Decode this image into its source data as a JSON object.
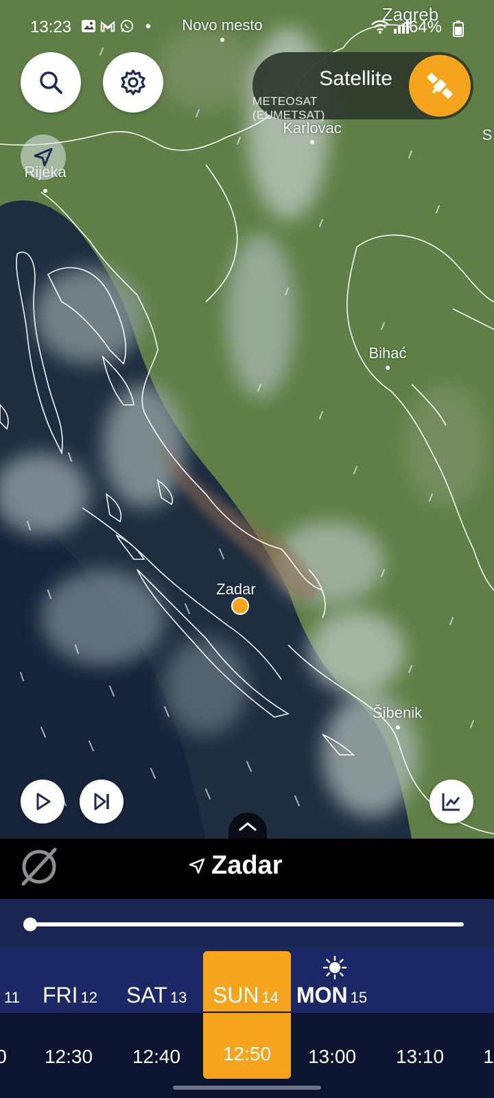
{
  "status_bar": {
    "time": "13:23",
    "battery": "64%",
    "icons": [
      "gallery-icon",
      "gmail-icon",
      "whatsapp-icon",
      "dot-icon"
    ],
    "system_icons": [
      "wifi-icon",
      "signal-icon",
      "battery-icon"
    ]
  },
  "map": {
    "cities": [
      {
        "name": "Novo mesto"
      },
      {
        "name": "Zagreb"
      },
      {
        "name": "Karlovac"
      },
      {
        "name": "S"
      },
      {
        "name": "Rijeka"
      },
      {
        "name": "Bihać"
      },
      {
        "name": "Zadar"
      },
      {
        "name": "Šibenik"
      }
    ],
    "selected_city": "Zadar",
    "colors": {
      "land": "#5e7d45",
      "sea": "#1c2a3e",
      "cloud": "#b9c4c3",
      "coast": "#ffffff",
      "marker": "#f5a41e"
    }
  },
  "layer": {
    "title": "Satellite",
    "subtitle": "METEOSAT (EUMETSAT)",
    "icon": "satellite-icon",
    "accent": "#f5a41e"
  },
  "controls": {
    "search": "search-icon",
    "settings": "gear-icon",
    "locate": "navigation-arrow-icon",
    "play": "play-icon",
    "skip": "skip-next-icon",
    "chart": "chart-icon",
    "expand": "chevron-up-icon"
  },
  "location_bar": {
    "name": "Zadar",
    "precip_icon": "no-precipitation-icon"
  },
  "timeline": {
    "progress": 0.0,
    "days": [
      {
        "label": "",
        "num": "11"
      },
      {
        "label": "FRI",
        "num": "12"
      },
      {
        "label": "SAT",
        "num": "13"
      },
      {
        "label": "SUN",
        "num": "14"
      },
      {
        "label": "MON",
        "num": "15"
      }
    ],
    "selected_day_index": 3,
    "times": [
      "0",
      "12:30",
      "12:40",
      "12:50",
      "13:00",
      "13:10",
      "1"
    ],
    "selected_time_index": 3,
    "day_icon": "sun-icon"
  }
}
